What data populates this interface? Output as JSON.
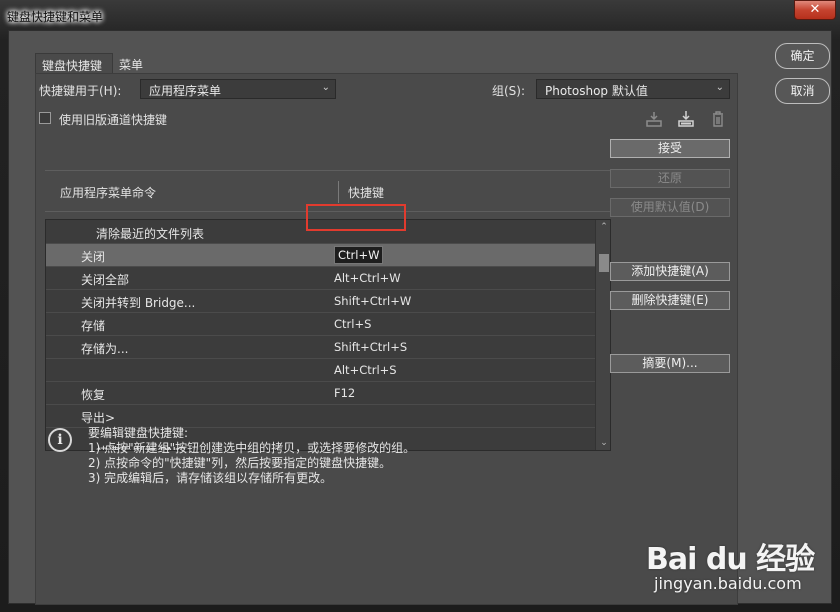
{
  "window": {
    "title": "键盘快捷键和菜单",
    "close_label": "✕"
  },
  "tabs": [
    {
      "label": "键盘快捷键"
    },
    {
      "label": "菜单"
    }
  ],
  "shortcuts_for": {
    "label": "快捷键用于(H):",
    "value": "应用程序菜单"
  },
  "group": {
    "label": "组(S):",
    "value": "Photoshop 默认值"
  },
  "legacy_checkbox": {
    "label": "使用旧版通道快捷键",
    "checked": false
  },
  "table": {
    "headers": [
      "应用程序菜单命令",
      "快捷键"
    ],
    "rows": [
      {
        "command": "清除最近的文件列表",
        "shortcut": ""
      },
      {
        "command": "关闭",
        "shortcut": "Ctrl+W",
        "selected": true
      },
      {
        "command": "关闭全部",
        "shortcut": "Alt+Ctrl+W"
      },
      {
        "command": "关闭并转到 Bridge...",
        "shortcut": "Shift+Ctrl+W"
      },
      {
        "command": "存储",
        "shortcut": "Ctrl+S"
      },
      {
        "command": "存储为...",
        "shortcut": "Shift+Ctrl+S"
      },
      {
        "command": "",
        "shortcut": "Alt+Ctrl+S"
      },
      {
        "command": "恢复",
        "shortcut": "F12"
      },
      {
        "command": "导出>",
        "shortcut": ""
      },
      {
        "command": "快速导出为 PNG",
        "shortcut": ""
      }
    ]
  },
  "side_buttons": {
    "accept": "接受",
    "undo": "还原",
    "use_default": "使用默认值(D)",
    "add_shortcut": "添加快捷键(A)",
    "delete_shortcut": "删除快捷键(E)",
    "summarize": "摘要(M)..."
  },
  "dialog_buttons": {
    "ok": "确定",
    "cancel": "取消"
  },
  "info": {
    "title": "要编辑键盘快捷键:",
    "lines": [
      "1) 点按\"新建组\"按钮创建选中组的拷贝，或选择要修改的组。",
      "2) 点按命令的\"快捷键\"列，然后按要指定的键盘快捷键。",
      "3) 完成编辑后，请存储该组以存储所有更改。"
    ]
  },
  "watermark": {
    "logo": "Bai du 经验",
    "url": "jingyan.baidu.com"
  }
}
